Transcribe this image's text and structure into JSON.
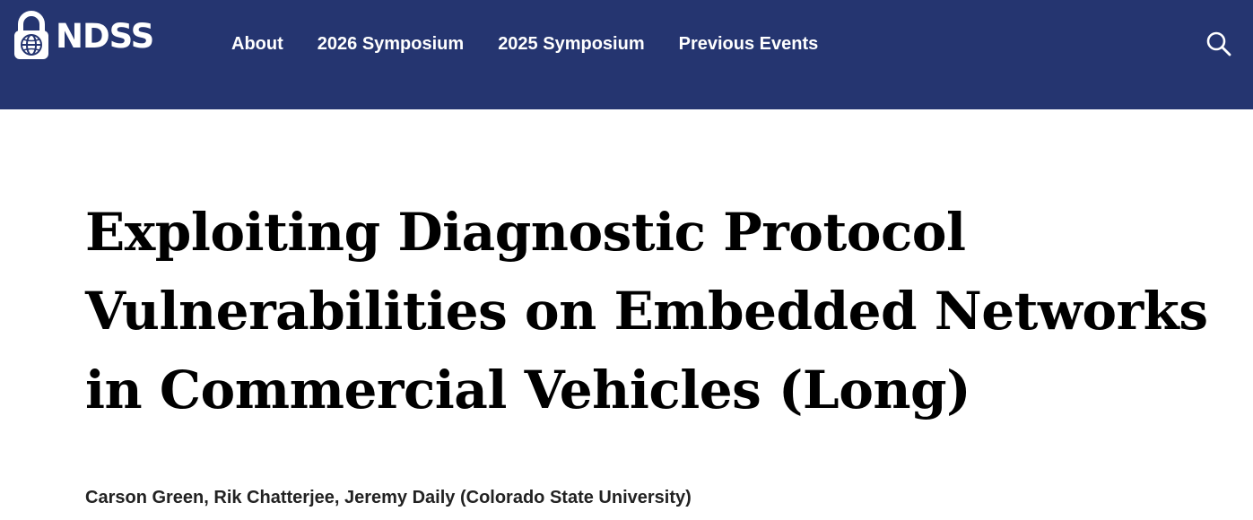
{
  "header": {
    "logo_text": "NDSS",
    "nav": [
      {
        "label": "About"
      },
      {
        "label": "2026 Symposium"
      },
      {
        "label": "2025 Symposium"
      },
      {
        "label": "Previous Events"
      }
    ],
    "search_icon": "search-icon"
  },
  "colors": {
    "navbar_bg": "#253570",
    "nav_text": "#ffffff",
    "title_text": "#000000"
  },
  "paper": {
    "title": "Exploiting Diagnostic Protocol Vulnerabilities on Embedded Networks in Commercial Vehicles (Long)",
    "authors": "Carson Green, Rik Chatterjee, Jeremy Daily (Colorado State University)"
  }
}
